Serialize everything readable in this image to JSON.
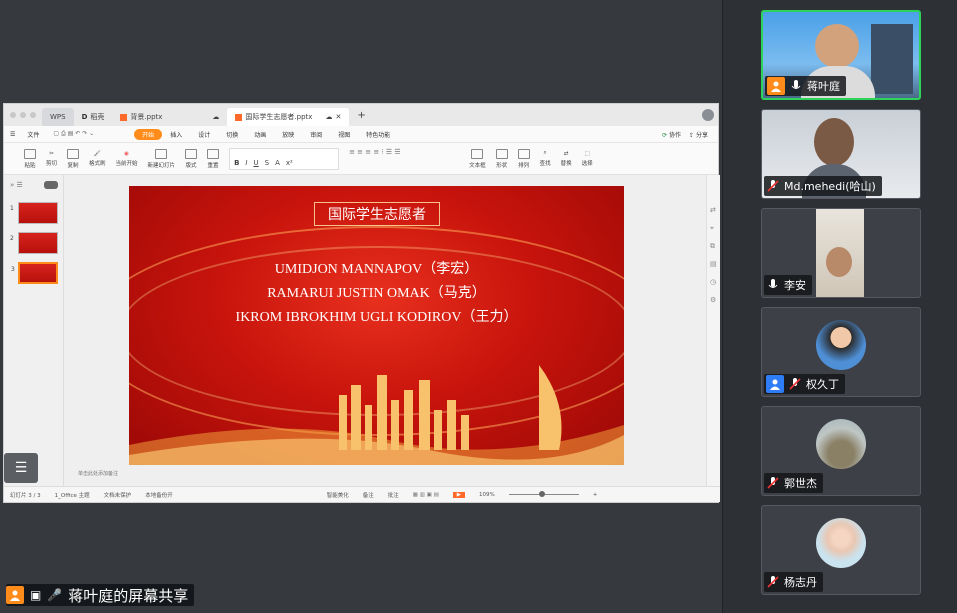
{
  "wps": {
    "app_tab": "WPS",
    "tab_stub": "稻壳",
    "tab_file1": "背景.pptx",
    "tab_doc": "国际学生志愿者.pptx",
    "menu": [
      "文件",
      "开始",
      "插入",
      "设计",
      "切换",
      "动画",
      "放映",
      "审阅",
      "视图",
      "特色功能"
    ],
    "menu_active_index": 1,
    "collab": "协作",
    "share": "分享",
    "ribbon": [
      "粘贴",
      "剪切",
      "复制",
      "格式刷",
      "当前开始",
      "新建幻灯片",
      "版式",
      "重置",
      "文本框",
      "形状",
      "排列",
      "查找",
      "替换",
      "选择"
    ],
    "slide_numbers": [
      "1",
      "2",
      "3"
    ],
    "notes_placeholder": "单击此处添加备注",
    "status": {
      "slide_index": "幻灯片 3 / 3",
      "theme": "1_Office 主题",
      "protect": "文档未保护",
      "backup": "本地备份开",
      "beautify": "智能美化",
      "notes": "备注",
      "comments": "批注",
      "zoom": "109%"
    }
  },
  "slide": {
    "title": "国际学生志愿者",
    "names": [
      "UMIDJON MANNAPOV（李宏）",
      "RAMARUI JUSTIN OMAK（马克）",
      "IKROM IBROKHIM UGLI KODIROV（王力）"
    ]
  },
  "participants": [
    {
      "name": "蒋叶庭",
      "host": true,
      "muted": false,
      "active": true
    },
    {
      "name": "Md.mehedi(哈山)",
      "host": false,
      "muted": true,
      "active": false
    },
    {
      "name": "李安",
      "host": false,
      "muted": false,
      "active": false
    },
    {
      "name": "权久丁",
      "host": false,
      "muted": true,
      "active": false,
      "blue_badge": true
    },
    {
      "name": "郭世杰",
      "host": false,
      "muted": true,
      "active": false
    },
    {
      "name": "杨志丹",
      "host": false,
      "muted": true,
      "active": false
    }
  ],
  "share_label": "蒋叶庭的屏幕共享",
  "colors": {
    "accent": "#ff8c1a",
    "active_border": "#2cd45a",
    "slide_red": "#c8140c"
  }
}
